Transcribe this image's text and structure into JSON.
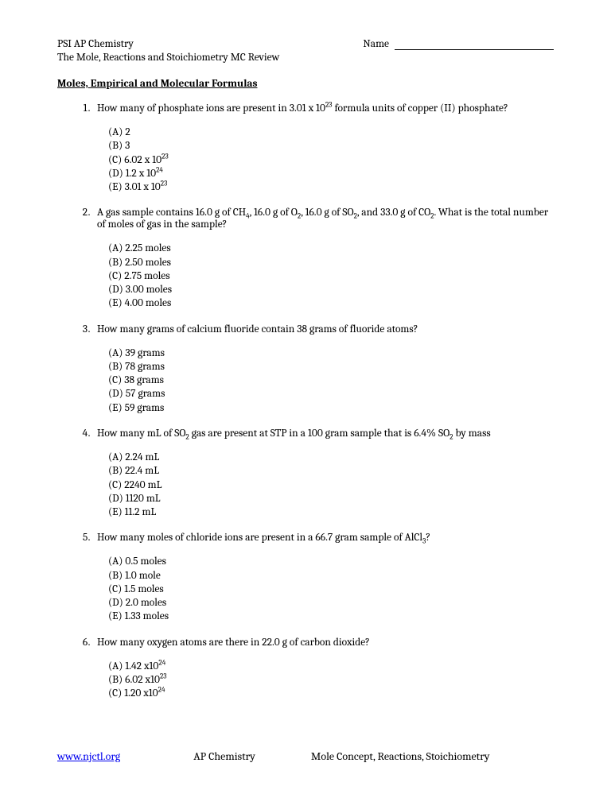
{
  "header": {
    "course": "PSI AP Chemistry",
    "name_label": "Name",
    "subtitle": "The Mole, Reactions and Stoichiometry MC Review"
  },
  "section_title": "Moles, Empirical and Molecular Formulas",
  "questions": [
    {
      "stem": "How many of phosphate ions are present in 3.01 x 10<sup>23</sup> formula units of copper (II) phosphate?",
      "choices": [
        "(A) 2",
        "(B) 3",
        "(C) 6.02 x 10<sup>23</sup>",
        "(D) 1.2 x 10<sup>24</sup>",
        "(E) 3.01 x 10<sup>23</sup>"
      ]
    },
    {
      "stem": "A gas sample contains 16.0 g of CH<sub>4</sub>, 16.0 g of O<sub>2</sub>, 16.0 g of SO<sub>2</sub>, and 33.0 g of CO<sub>2</sub>.  What is the total number of moles of gas in the sample?",
      "choices": [
        "(A) 2.25 moles",
        "(B) 2.50 moles",
        "(C) 2.75 moles",
        "(D) 3.00 moles",
        "(E) 4.00 moles"
      ]
    },
    {
      "stem": "How many grams of calcium fluoride contain 38 grams of fluoride atoms?",
      "choices": [
        "(A) 39 grams",
        "(B) 78 grams",
        "(C) 38 grams",
        "(D) 57 grams",
        "(E) 59 grams"
      ]
    },
    {
      "stem": "How many mL of SO<sub>2</sub> gas are present at STP in a 100 gram sample that is 6.4% SO<sub>2</sub> by mass",
      "choices": [
        "(A) 2.24 mL",
        "(B) 22.4 mL",
        "(C) 2240 mL",
        "(D) 1120 mL",
        "(E) 11.2 mL"
      ]
    },
    {
      "stem": "How many moles of chloride ions are present in a 66.7 gram sample of AlCl<sub>3</sub>?",
      "choices": [
        "(A) 0.5 moles",
        "(B) 1.0 mole",
        "(C) 1.5 moles",
        "(D) 2.0 moles",
        "(E) 1.33 moles"
      ]
    },
    {
      "stem": "How many oxygen atoms are there in 22.0 g of carbon dioxide?",
      "choices": [
        "(A) 1.42 x10<sup>24</sup>",
        "(B) 6.02 x10<sup>23</sup>",
        "(C) 1.20 x10<sup>24</sup>"
      ]
    }
  ],
  "footer": {
    "link": "www.njctl.org",
    "center": "AP Chemistry",
    "right": "Mole Concept, Reactions, Stoichiometry"
  }
}
